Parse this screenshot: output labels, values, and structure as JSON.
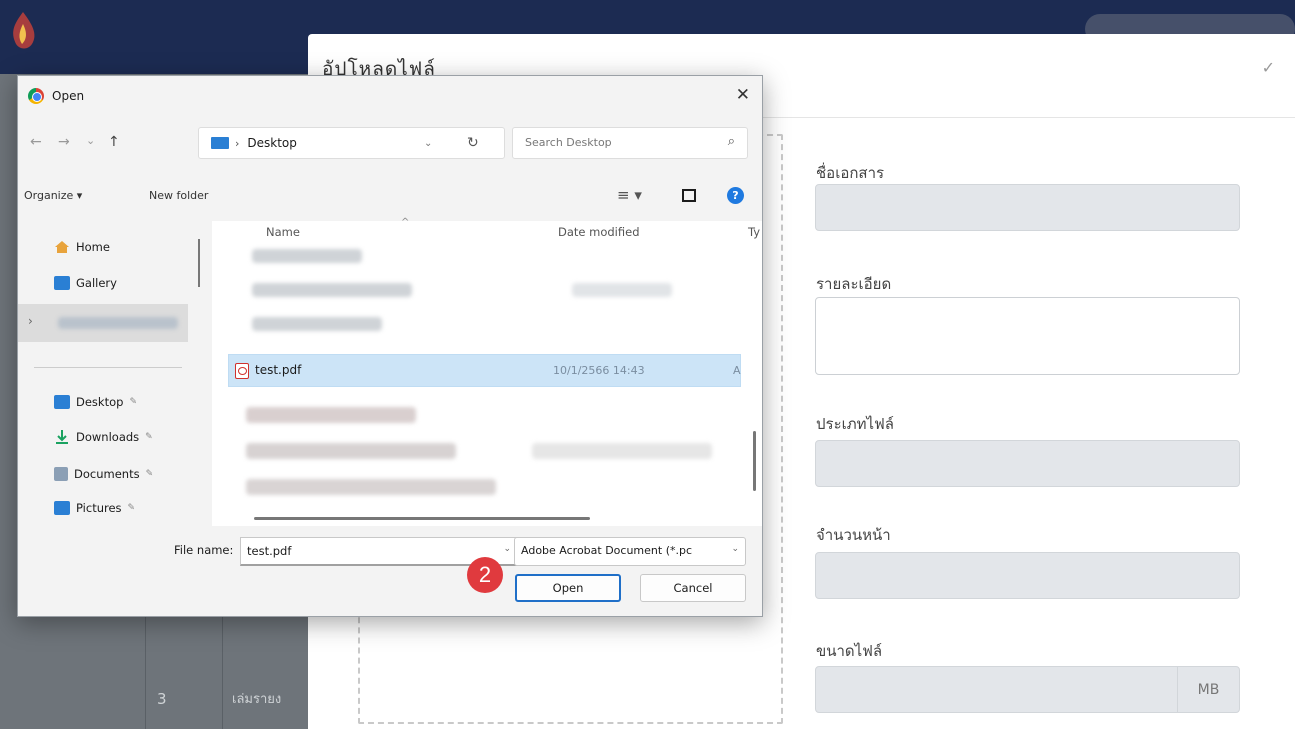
{
  "modal": {
    "title": "อัปโหลดไฟล์",
    "close_icon": "✓",
    "fields": {
      "doc_name_label": "ชื่อเอกสาร",
      "description_label": "รายละเอียด",
      "file_type_label": "ประเภทไฟล์",
      "page_count_label": "จำนวนหน้า",
      "file_size_label": "ขนาดไฟล์",
      "file_size_unit": "MB"
    }
  },
  "background": {
    "row_number": "3",
    "row_text": "เล่มรายง"
  },
  "dialog": {
    "title": "Open",
    "close": "✕",
    "nav": {
      "back": "←",
      "forward": "→",
      "recent": "⌄",
      "up": "↑"
    },
    "address": {
      "sep": "›",
      "folder": "Desktop",
      "dropdown": "⌄",
      "refresh": "↻"
    },
    "search_placeholder": "Search Desktop",
    "search_icon": "⌕",
    "organize": "Organize ▾",
    "new_folder": "New folder",
    "view_icon": "≡ ▾",
    "help_icon": "?",
    "nav_items": [
      {
        "label": "Home",
        "icon": "home-icon"
      },
      {
        "label": "Gallery",
        "icon": "gallery-icon"
      },
      {
        "label": "Desktop",
        "icon": "desktop-folder-icon",
        "pinned": true
      },
      {
        "label": "Downloads",
        "icon": "downloads-icon",
        "pinned": true
      },
      {
        "label": "Documents",
        "icon": "documents-icon",
        "pinned": true
      },
      {
        "label": "Pictures",
        "icon": "pictures-icon",
        "pinned": true
      }
    ],
    "pin_icon": "✎",
    "expand_chevron": "›",
    "columns": {
      "name": "Name",
      "date": "Date modified",
      "type": "Ty",
      "sort_icon": "^"
    },
    "selected_file": {
      "name": "test.pdf",
      "date": "10/1/2566 14:43",
      "type": "A"
    },
    "file_name_label": "File name:",
    "file_name_value": "test.pdf",
    "file_type_value": "Adobe Acrobat Document (*.pc",
    "open_button": "Open",
    "cancel_button": "Cancel",
    "dropdown_icon": "⌄"
  },
  "step_badge": "2",
  "colors": {
    "accent": "#1f6fc8",
    "badge": "#e03a3e",
    "selection": "#cce4f7",
    "header": "#1c2b52"
  }
}
